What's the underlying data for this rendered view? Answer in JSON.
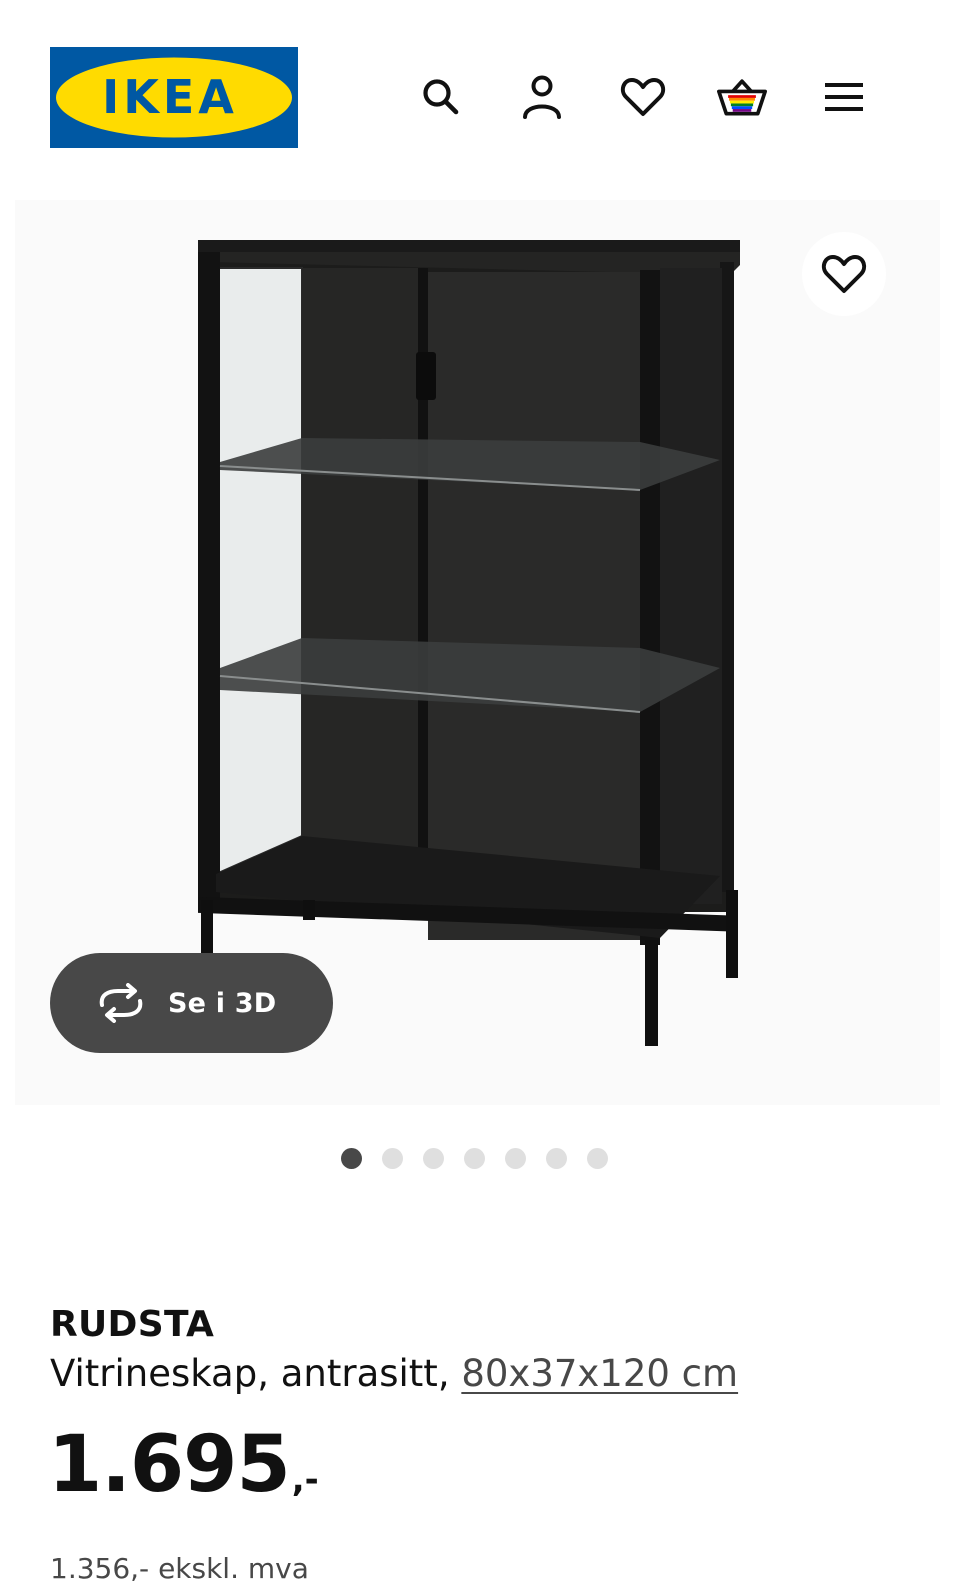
{
  "header": {
    "logo_text": "IKEA",
    "icons": [
      "search-icon",
      "account-icon",
      "heart-icon",
      "basket-icon",
      "menu-icon"
    ]
  },
  "gallery": {
    "favourite_icon": "heart-icon",
    "view_3d_label": "Se i 3D",
    "view_3d_icon": "rotate-icon",
    "image_count": 7,
    "active_image": 1
  },
  "product": {
    "name": "RUDSTA",
    "description": "Vitrineskap, antrasitt,",
    "measurements": "80x37x120 cm",
    "price": "1.695",
    "price_suffix": ",-",
    "price_ex_vat": "1.356,- ekskl. mva"
  },
  "colors": {
    "ikea_blue": "#0058a3",
    "ikea_yellow": "#ffdb00",
    "button_dark": "#484848",
    "text": "#111111"
  }
}
